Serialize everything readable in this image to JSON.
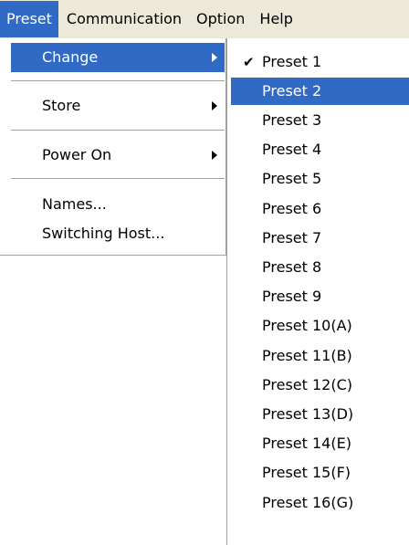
{
  "menubar": {
    "items": [
      "Preset",
      "Communication",
      "Option",
      "Help"
    ]
  },
  "preset_menu": {
    "change": "Change",
    "store": "Store",
    "power_on": "Power On",
    "names": "Names...",
    "switching_host": "Switching Host..."
  },
  "change_submenu": {
    "checked_item": "Preset 1",
    "selected_item": "Preset 2",
    "items": [
      "Preset 1",
      "Preset 2",
      "Preset 3",
      "Preset 4",
      "Preset 5",
      "Preset 6",
      "Preset 7",
      "Preset 8",
      "Preset 9",
      "Preset 10(A)",
      "Preset 11(B)",
      "Preset 12(C)",
      "Preset 13(D)",
      "Preset 14(E)",
      "Preset 15(F)",
      "Preset 16(G)"
    ]
  },
  "icons": {
    "check": "checkmark-icon",
    "submenu_arrow": "submenu-arrow-icon"
  },
  "colors": {
    "highlight": "#316ac5",
    "menubar_bg": "#ece9d8"
  }
}
